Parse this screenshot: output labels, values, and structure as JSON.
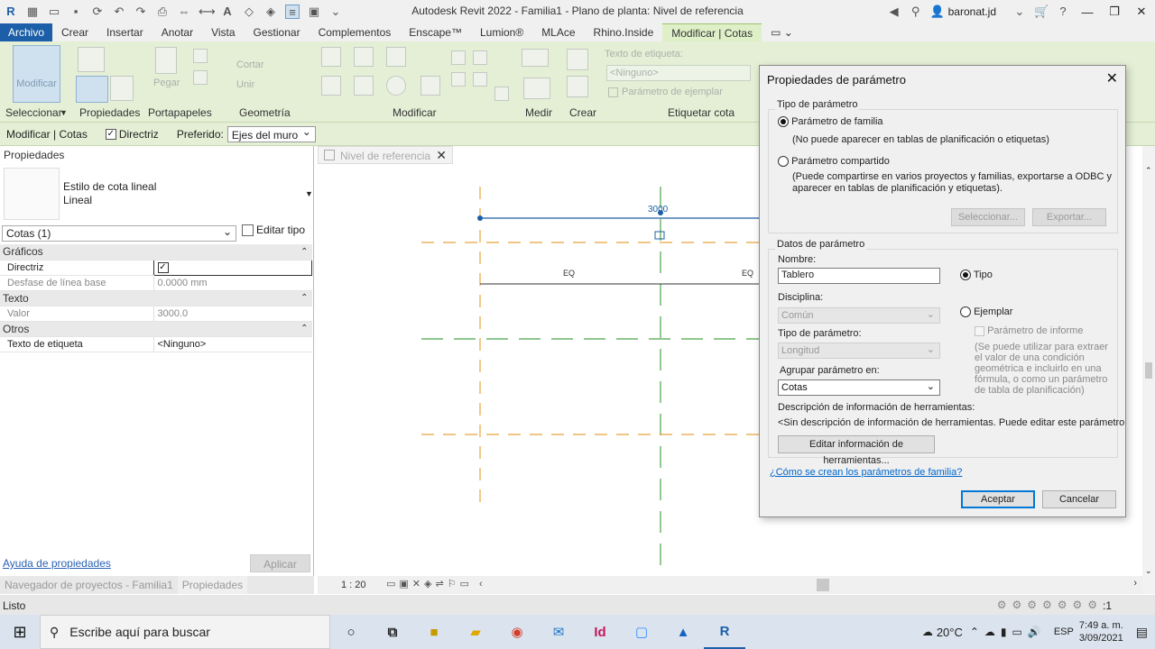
{
  "titlebar": {
    "title": "Autodesk Revit 2022 - Familia1 - Plano de planta: Nivel de referencia",
    "user": "baronat.jd"
  },
  "menu": {
    "file": "Archivo",
    "tabs": [
      "Crear",
      "Insertar",
      "Anotar",
      "Vista",
      "Gestionar",
      "Complementos",
      "Enscape™",
      "Lumion®",
      "MLAce",
      "Rhino.Inside",
      "Modificar | Cotas"
    ]
  },
  "ribbon": {
    "modify_label": "Modificar",
    "cut": "Cortar",
    "join": "Unir",
    "paste": "Pegar",
    "label_text": "Texto de etiqueta:",
    "label_none": "<Ninguno>",
    "instance_param": "Parámetro de ejemplar",
    "groups": [
      "Seleccionar",
      "Propiedades",
      "Portapapeles",
      "Geometría",
      "Modificar",
      "Medir",
      "Crear",
      "Etiquetar cota"
    ]
  },
  "options_bar": {
    "context": "Modificar | Cotas",
    "leader_label": "Directriz",
    "preferred_label": "Preferido:",
    "preferred_value": "Ejes del muro"
  },
  "properties": {
    "header": "Propiedades",
    "type_family": "Estilo de cota lineal",
    "type_name": "Lineal",
    "filter": "Cotas (1)",
    "edit_type": "Editar tipo",
    "rows": {
      "cat_graphics": "Gráficos",
      "leader": "Directriz",
      "baseline_offset": "Desfase de línea base",
      "baseline_offset_val": "0.0000 mm",
      "cat_text": "Texto",
      "value": "Valor",
      "value_val": "3000.0",
      "cat_other": "Otros",
      "label_text": "Texto de etiqueta",
      "label_text_val": "<Ninguno>"
    },
    "help_link": "Ayuda de propiedades",
    "apply": "Aplicar",
    "tab_browser": "Navegador de proyectos - Familia1",
    "tab_props": "Propiedades"
  },
  "view": {
    "tab": "Nivel de referencia",
    "dim_value": "3000",
    "eq_left": "EQ",
    "eq_right": "EQ",
    "scale": "1 : 20"
  },
  "status": {
    "text": "Listo",
    "filter_count": ":1"
  },
  "dialog": {
    "title": "Propiedades de parámetro",
    "param_type_group": "Tipo de parámetro",
    "family_param": "Parámetro de familia",
    "family_param_note": "(No puede aparecer en tablas de planificación o etiquetas)",
    "shared_param": "Parámetro compartido",
    "shared_param_note_1": "(Puede compartirse en varios proyectos y familias, exportarse a ODBC y",
    "shared_param_note_2": "aparecer en tablas de planificación y etiquetas).",
    "select_btn": "Seleccionar...",
    "export_btn": "Exportar...",
    "data_group": "Datos de parámetro",
    "name_label": "Nombre:",
    "name_value": "Tablero",
    "type_radio": "Tipo",
    "discipline_label": "Disciplina:",
    "discipline_value": "Común",
    "instance_radio": "Ejemplar",
    "report_param": "Parámetro de informe",
    "report_note_1": "(Se puede utilizar para extraer",
    "report_note_2": "el valor de una condición",
    "report_note_3": "geométrica e incluirlo en una",
    "report_note_4": "fórmula, o como un parámetro",
    "report_note_5": "de tabla de planificación)",
    "ptype_label": "Tipo de parámetro:",
    "ptype_value": "Longitud",
    "group_label": "Agrupar parámetro en:",
    "group_value": "Cotas",
    "tooltip_label": "Descripción de información de herramientas:",
    "tooltip_value": "<Sin descripción de información de herramientas. Puede editar este parámetro",
    "edit_tooltip_btn": "Editar información de herramientas...",
    "help_link": "¿Cómo se crean los parámetros de familia?",
    "ok": "Aceptar",
    "cancel": "Cancelar"
  },
  "taskbar": {
    "search_placeholder": "Escribe aquí para buscar",
    "temperature": "20°C",
    "language": "ESP",
    "time": "7:49 a. m.",
    "date": "3/09/2021"
  },
  "colors": {
    "accent": "#1c5fa8",
    "ribbon": "#e4efd6",
    "grid_orange": "#e8a33c",
    "grid_green": "#4aa54a"
  }
}
